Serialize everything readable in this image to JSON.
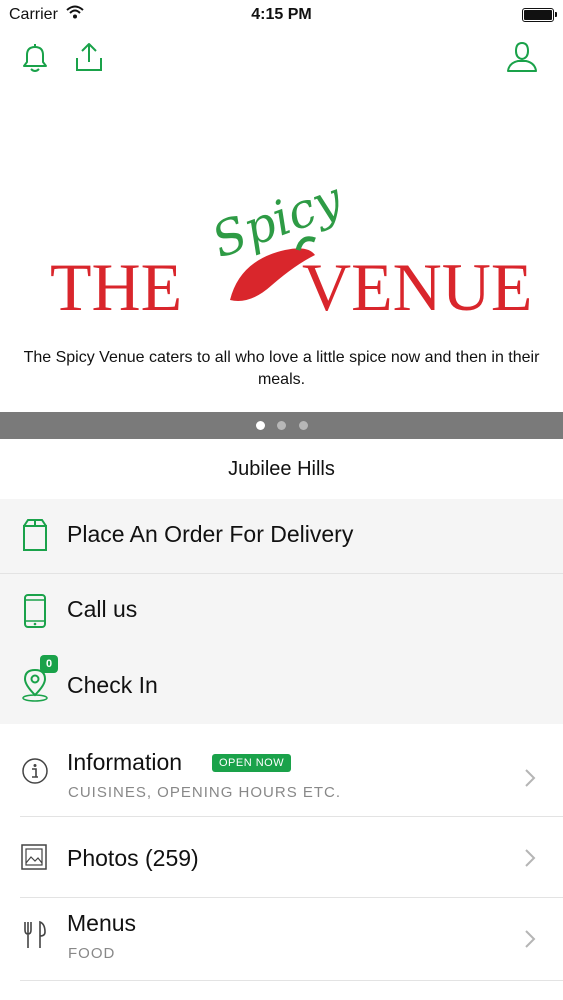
{
  "status_bar": {
    "carrier": "Carrier",
    "time": "4:15 PM"
  },
  "hero": {
    "logo_text_left": "THE",
    "logo_text_script": "Spicy",
    "logo_text_right": "VENUE",
    "description": "The Spicy Venue caters to all who love a little spice now and then in their meals.",
    "pages": 3,
    "active_page": 1
  },
  "location": "Jubilee Hills",
  "actions": {
    "delivery": "Place An Order For Delivery",
    "call": "Call us",
    "checkin": "Check In",
    "checkin_count": "0"
  },
  "menu": {
    "information": {
      "title": "Information",
      "badge": "OPEN NOW",
      "subtitle": "CUISINES, OPENING HOURS ETC."
    },
    "photos": {
      "title": "Photos (259)"
    },
    "menus": {
      "title": "Menus",
      "subtitle": "FOOD"
    }
  },
  "colors": {
    "accent": "#1aa24a",
    "logo_red": "#d9262c",
    "logo_green": "#2e9b45",
    "pager_bar": "#7a7a7a"
  },
  "icons": [
    "bell-icon",
    "share-icon",
    "user-icon",
    "bag-icon",
    "phone-icon",
    "location-pin-icon",
    "info-icon",
    "photos-icon",
    "cutlery-icon",
    "chevron-right-icon"
  ]
}
